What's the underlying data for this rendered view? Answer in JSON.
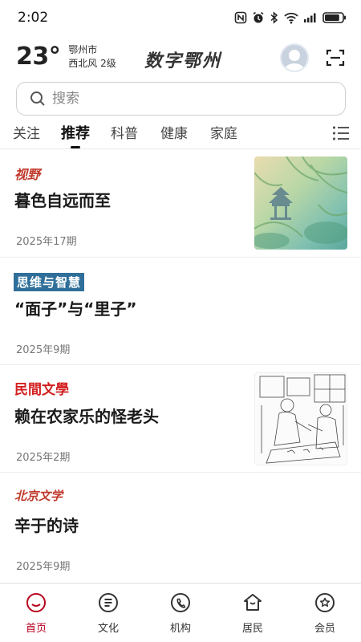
{
  "status": {
    "time": "2:02",
    "battery_level": 0.85
  },
  "header": {
    "temperature": "23°",
    "city": "鄂州市",
    "wind": "西北风  2级",
    "app_logo_text": "数字鄂州"
  },
  "search": {
    "placeholder": "搜索"
  },
  "tabs": [
    {
      "label": "关注"
    },
    {
      "label": "推荐"
    },
    {
      "label": "科普"
    },
    {
      "label": "健康"
    },
    {
      "label": "家庭"
    }
  ],
  "articles": [
    {
      "source": "视野",
      "source_color": "#c0392b",
      "title": "暮色自远而至",
      "issue": "2025年17期",
      "has_thumb": true
    },
    {
      "source": "思维与智慧",
      "source_color": "#2f6f9a",
      "title": "“面子”与“里子”",
      "issue": "2025年9期",
      "has_thumb": false
    },
    {
      "source": "民間文學",
      "source_color": "#d31f1f",
      "title": "赖在农家乐的怪老头",
      "issue": "2025年2期",
      "has_thumb": true
    },
    {
      "source": "北京文学",
      "source_color": "#c0392b",
      "title": "辛于的诗",
      "issue": "2025年9期",
      "has_thumb": false
    }
  ],
  "bottom_nav": [
    {
      "label": "首页",
      "icon": "home-icon",
      "active": true
    },
    {
      "label": "文化",
      "icon": "culture-icon",
      "active": false
    },
    {
      "label": "机构",
      "icon": "phone-icon",
      "active": false
    },
    {
      "label": "居民",
      "icon": "residents-icon",
      "active": false
    },
    {
      "label": "会员",
      "icon": "member-icon",
      "active": false
    }
  ],
  "colors": {
    "accent": "#b8001c",
    "text": "#222222"
  }
}
